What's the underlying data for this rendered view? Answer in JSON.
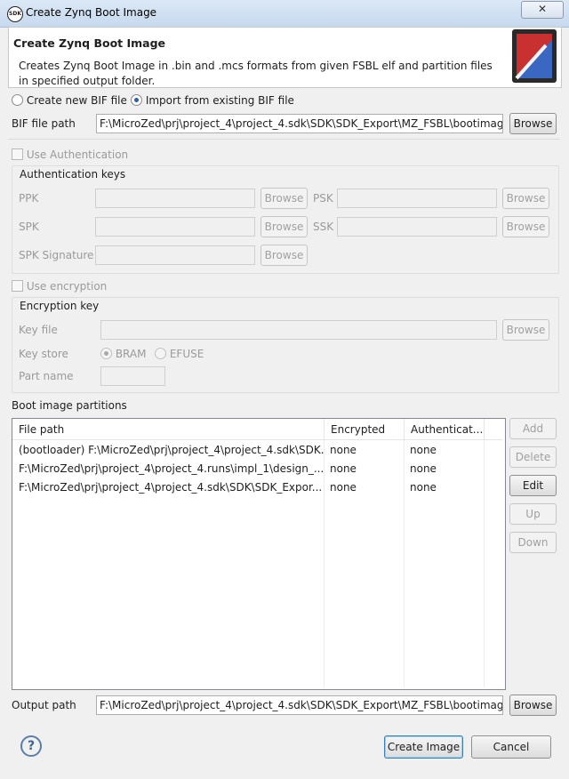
{
  "window": {
    "title": "Create Zynq Boot Image",
    "close": "✕"
  },
  "header": {
    "title": "Create Zynq Boot Image",
    "description": "Creates Zynq Boot Image in .bin and .mcs formats from given FSBL elf and partition files in specified output folder."
  },
  "bif_mode": {
    "new_label": "Create new BIF file",
    "import_label": "Import from existing BIF file",
    "selected": "import"
  },
  "bif_path": {
    "label": "BIF file path",
    "value": "F:\\MicroZed\\prj\\project_4\\project_4.sdk\\SDK\\SDK_Export\\MZ_FSBL\\bootimage\\MZ_FSBL.bif",
    "browse": "Browse"
  },
  "authentication": {
    "checkbox_label": "Use Authentication",
    "group_label": "Authentication keys",
    "ppk": "PPK",
    "psk": "PSK",
    "spk": "SPK",
    "ssk": "SSK",
    "spk_signature": "SPK Signature",
    "browse": "Browse"
  },
  "encryption": {
    "checkbox_label": "Use encryption",
    "group_label": "Encryption key",
    "key_file": "Key file",
    "key_store": "Key store",
    "bram": "BRAM",
    "efuse": "EFUSE",
    "part_name": "Part name",
    "browse": "Browse"
  },
  "partitions": {
    "label": "Boot image partitions",
    "columns": [
      "File path",
      "Encrypted",
      "Authenticat..."
    ],
    "rows": [
      {
        "path": "(bootloader) F:\\MicroZed\\prj\\project_4\\project_4.sdk\\SDK...",
        "encrypted": "none",
        "auth": "none"
      },
      {
        "path": "F:\\MicroZed\\prj\\project_4\\project_4.runs\\impl_1\\design_...",
        "encrypted": "none",
        "auth": "none"
      },
      {
        "path": "F:\\MicroZed\\prj\\project_4\\project_4.sdk\\SDK\\SDK_Expor...",
        "encrypted": "none",
        "auth": "none"
      }
    ],
    "buttons": {
      "add": "Add",
      "delete": "Delete",
      "edit": "Edit",
      "up": "Up",
      "down": "Down"
    }
  },
  "output": {
    "label": "Output path",
    "value": "F:\\MicroZed\\prj\\project_4\\project_4.sdk\\SDK\\SDK_Export\\MZ_FSBL\\bootimage\\BOOT.bin",
    "browse": "Browse"
  },
  "footer": {
    "help": "?",
    "create": "Create Image",
    "cancel": "Cancel"
  }
}
